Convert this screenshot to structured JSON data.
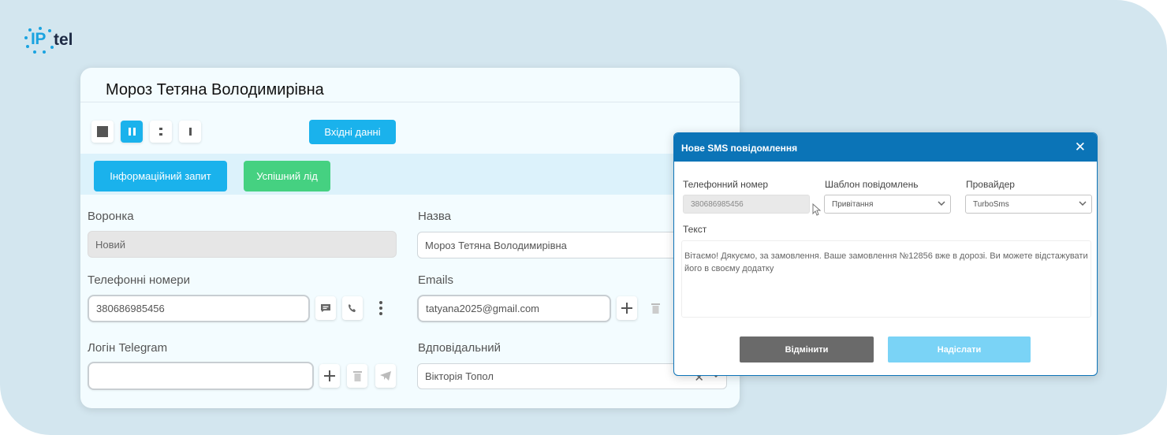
{
  "brand": {
    "logo_ip": "IP",
    "logo_tel": "tel",
    "accent": "#1ab2ec",
    "success": "#45d181",
    "modal_header": "#0b74b7"
  },
  "contact": {
    "name": "Мороз Тетяна Володимирівна",
    "controls": [
      "stop-icon",
      "pause-icon",
      "colon-icon",
      "bar-icon"
    ],
    "input_data_button": "Вхідні данні",
    "info_request_button": "Інформаційний запит",
    "success_lead_button": "Успішний лід",
    "funnel": {
      "label": "Воронка",
      "value": "Новий"
    },
    "title_field": {
      "label": "Назва",
      "value": "Мороз Тетяна Володимирівна"
    },
    "phones": {
      "label": "Телефонні номери",
      "value": "380686985456"
    },
    "emails": {
      "label": "Emails",
      "value": "tatyana2025@gmail.com"
    },
    "telegram": {
      "label": "Логін Telegram",
      "value": ""
    },
    "responsible": {
      "label": "Вдповідальний",
      "value": "Вікторія Топол"
    }
  },
  "sms_modal": {
    "title": "Нове SMS повідомлення",
    "close_label": "✕",
    "phone": {
      "label": "Телефонний номер",
      "value": "380686985456"
    },
    "template": {
      "label": "Шаблон повідомлень",
      "value": "Привітання"
    },
    "provider": {
      "label": "Провайдер",
      "value": "TurboSms"
    },
    "text_label": "Текст",
    "text_value": "Вітаємо! Дякуємо, за замовлення. Ваше замовлення №12856 вже в дорозі. Ви можете відстажувати його в своєму додатку",
    "cancel_button": "Відмінити",
    "send_button": "Надіслати"
  }
}
